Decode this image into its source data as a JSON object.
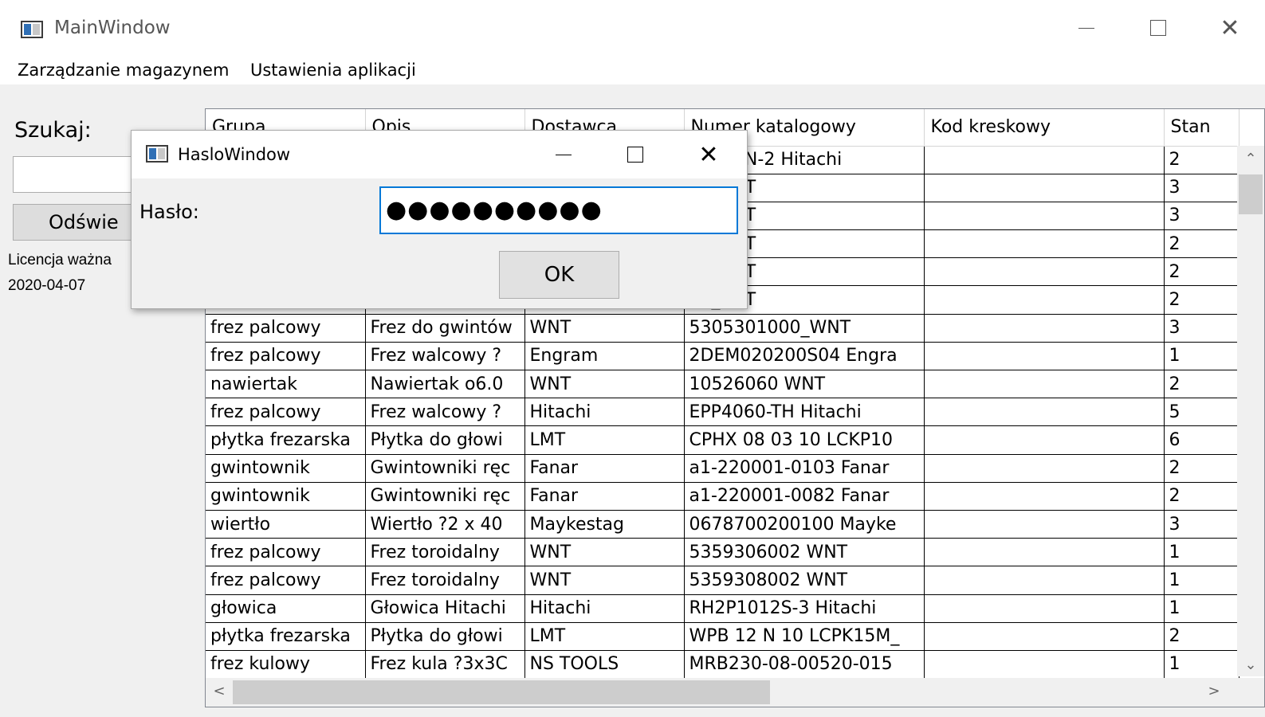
{
  "main_window": {
    "title": "MainWindow",
    "caption": {
      "minimize": "—",
      "close": "✕"
    },
    "menu": [
      "Zarządzanie magazynem",
      "Ustawienia aplikacji"
    ],
    "search_label": "Szukaj:",
    "search_value": "",
    "refresh_label": "Odświe",
    "license_label": "Licencja ważna",
    "license_date": "2020-04-07"
  },
  "grid": {
    "columns": [
      "Grupa",
      "Opis",
      "Dostawca",
      "Numer katalogowy",
      "Kod kreskowy",
      "Stan"
    ],
    "rows": [
      [
        "",
        "",
        "",
        "0402TN-2 Hitachi",
        "",
        "2"
      ],
      [
        "",
        "",
        "",
        "72_LMT",
        "",
        "3"
      ],
      [
        "",
        "",
        "",
        "71_LMT",
        "",
        "3"
      ],
      [
        "",
        "",
        "",
        "70_LMT",
        "",
        "2"
      ],
      [
        "",
        "",
        "",
        "99_LMT",
        "",
        "2"
      ],
      [
        "",
        "",
        "",
        "97_LMT",
        "",
        "2"
      ],
      [
        "frez palcowy",
        "Frez do gwintów",
        "WNT",
        "5305301000_WNT",
        "",
        "3"
      ],
      [
        "frez palcowy",
        "Frez walcowy ?",
        "Engram",
        "2DEM020200S04 Engra",
        "",
        "1"
      ],
      [
        "nawiertak",
        "Nawiertak o6.0",
        "WNT",
        "10526060 WNT",
        "",
        "2"
      ],
      [
        "frez palcowy",
        "Frez walcowy ?",
        "Hitachi",
        "EPP4060-TH Hitachi",
        "",
        "5"
      ],
      [
        "płytka frezarska",
        "Płytka do głowi",
        "LMT",
        "CPHX 08 03 10 LCKP10",
        "",
        "6"
      ],
      [
        "gwintownik",
        "Gwintowniki ręc",
        "Fanar",
        "a1-220001-0103 Fanar",
        "",
        "2"
      ],
      [
        "gwintownik",
        "Gwintowniki ręc",
        "Fanar",
        "a1-220001-0082 Fanar",
        "",
        "2"
      ],
      [
        "wiertło",
        "Wiertło ?2 x 40",
        "Maykestag",
        "0678700200100 Mayke",
        "",
        "3"
      ],
      [
        "frez palcowy",
        "Frez toroidalny",
        "WNT",
        "5359306002 WNT",
        "",
        "1"
      ],
      [
        "frez palcowy",
        "Frez toroidalny",
        "WNT",
        "5359308002 WNT",
        "",
        "1"
      ],
      [
        "głowica",
        "Głowica Hitachi",
        "Hitachi",
        "RH2P1012S-3 Hitachi",
        "",
        "1"
      ],
      [
        "płytka frezarska",
        "Płytka do głowi",
        "LMT",
        "WPB 12 N 10 LCPK15M_",
        "",
        "2"
      ],
      [
        "frez kulowy",
        "Frez kula ?3x3C",
        "NS TOOLS",
        "MRB230-08-00520-015",
        "",
        "1"
      ]
    ]
  },
  "dialog": {
    "title": "HasloWindow",
    "password_label": "Hasło:",
    "password_mask": "●●●●●●●●●●",
    "ok_label": "OK"
  }
}
